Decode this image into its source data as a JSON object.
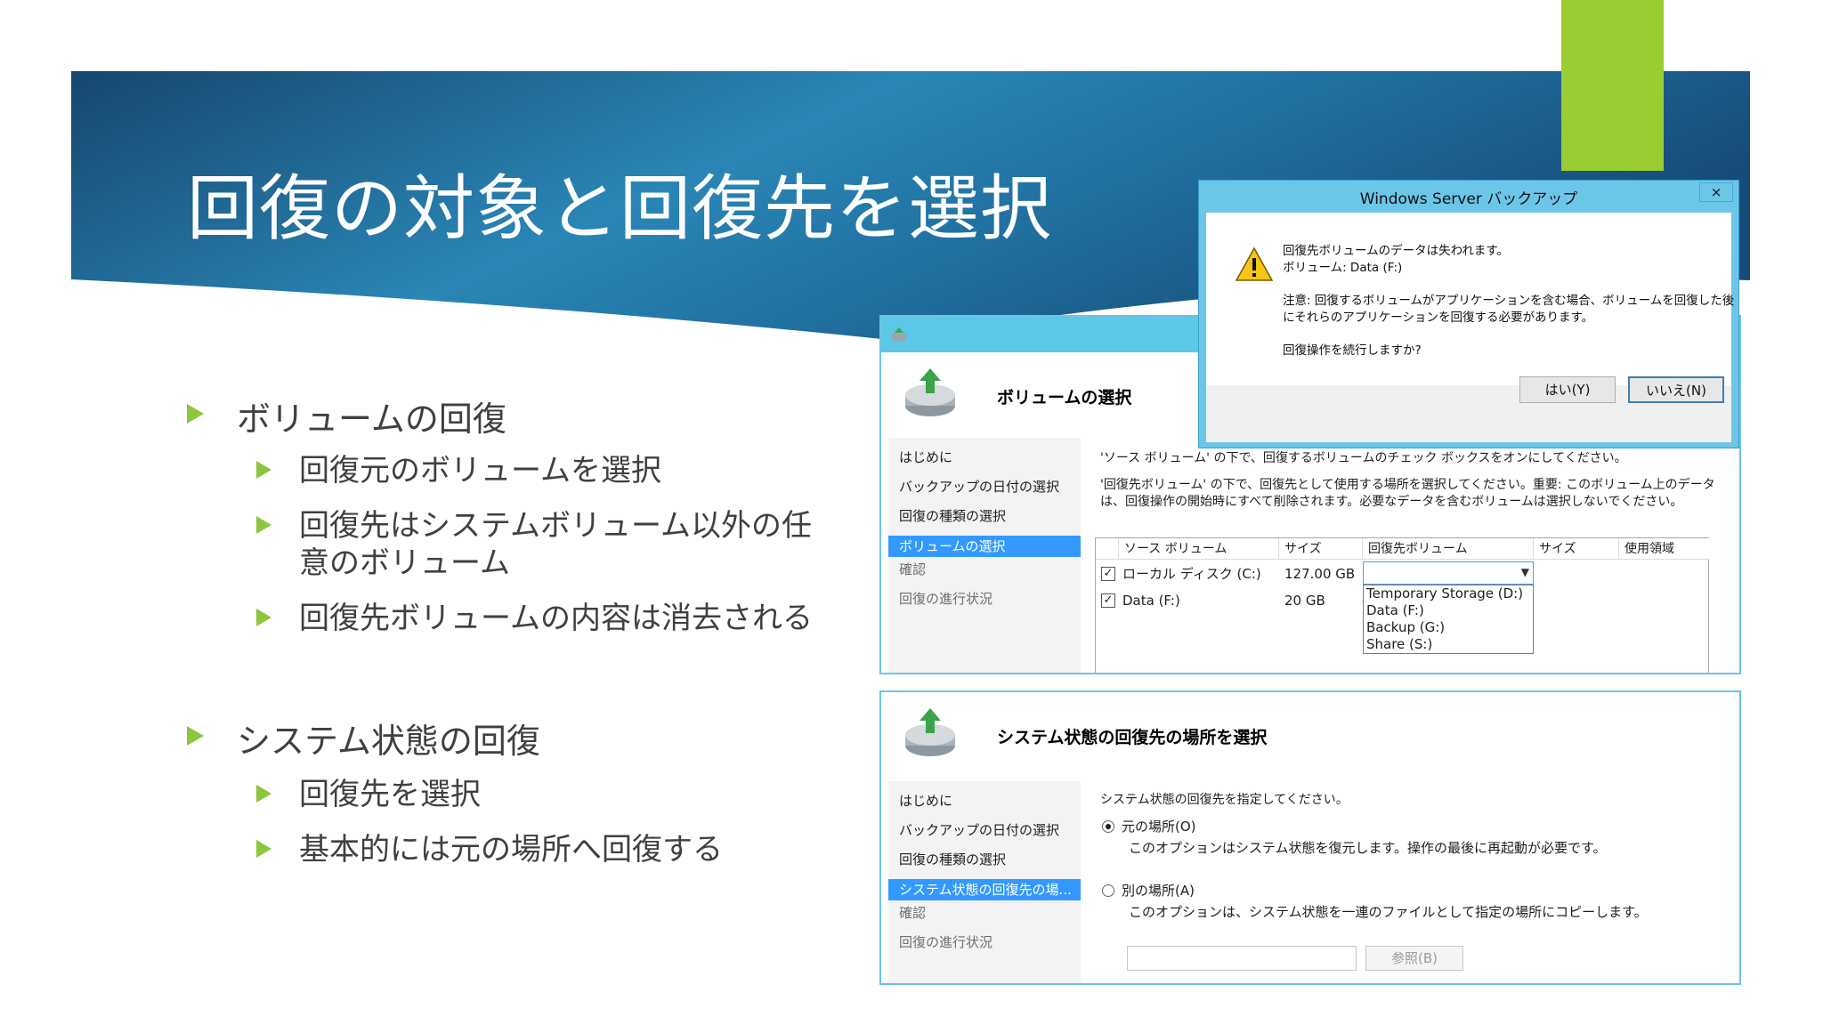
{
  "slide": {
    "title": "回復の対象と回復先を選択",
    "bullets": [
      {
        "label": "ボリュームの回復",
        "sub": [
          "回復元のボリュームを選択",
          "回復先はシステムボリューム以外の任意のボリューム",
          "回復先ボリュームの内容は消去される"
        ]
      },
      {
        "label": "システム状態の回復",
        "sub": [
          "回復先を選択",
          "基本的には元の場所へ回復する"
        ]
      }
    ]
  },
  "colors": {
    "banner_dark": "#16466f",
    "banner_light": "#2e8fc0",
    "accent_green": "#8cc63f",
    "green_tab": "#9acd32",
    "selection_blue": "#3399ff"
  },
  "volume_wizard": {
    "header_title": "ボリュームの選択",
    "nav": [
      "はじめに",
      "バックアップの日付の選択",
      "回復の種類の選択",
      "ボリュームの選択",
      "確認",
      "回復の進行状況"
    ],
    "instruction1": "'ソース ボリューム' の下で、回復するボリュームのチェック ボックスをオンにしてください。",
    "instruction2": "'回復先ボリューム' の下で、回復先として使用する場所を選択してください。重要: このボリューム上のデータは、回復操作の開始時にすべて削除されます。必要なデータを含むボリュームは選択しないでください。",
    "columns": [
      "ソース ボリューム",
      "サイズ",
      "回復先ボリューム",
      "サイズ",
      "使用領域"
    ],
    "rows": [
      {
        "source": "ローカル ディスク (C:)",
        "size": "127.00 GB",
        "checked": true
      },
      {
        "source": "Data (F:)",
        "size": "20 GB",
        "checked": true
      }
    ],
    "dropdown_options": [
      "Temporary Storage (D:)",
      "Data (F:)",
      "Backup (G:)",
      "Share (S:)"
    ]
  },
  "system_state_wizard": {
    "header_title": "システム状態の回復先の場所を選択",
    "nav": [
      "はじめに",
      "バックアップの日付の選択",
      "回復の種類の選択",
      "システム状態の回復先の場...",
      "確認",
      "回復の進行状況"
    ],
    "prompt": "システム状態の回復先を指定してください。",
    "option_original": "元の場所(O)",
    "option_original_desc": "このオプションはシステム状態を復元します。操作の最後に再起動が必要です。",
    "option_alternate": "別の場所(A)",
    "option_alternate_desc": "このオプションは、システム状態を一連のファイルとして指定の場所にコピーします。",
    "selected_option": "元の場所(O)",
    "browse_label": "参照(B)"
  },
  "dialog": {
    "title": "Windows Server バックアップ",
    "close_label": "×",
    "line1": "回復先ボリュームのデータは失われます。",
    "line2": "ボリューム: Data (F:)",
    "note1": "注意: 回復するボリュームがアプリケーションを含む場合、ボリュームを回復した後",
    "note2": "にそれらのアプリケーションを回復する必要があります。",
    "question": "回復操作を続行しますか?",
    "yes_label": "はい(Y)",
    "no_label": "いいえ(N)"
  }
}
